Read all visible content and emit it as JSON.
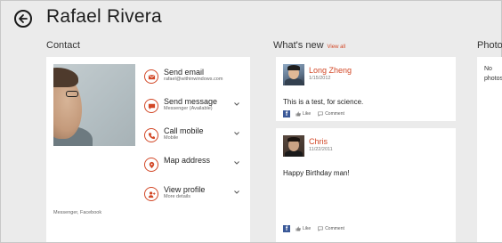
{
  "header": {
    "title": "Rafael Rivera"
  },
  "contact": {
    "heading": "Contact",
    "photo_caption": "Messenger, Facebook",
    "actions": [
      {
        "label": "Send email",
        "sub": "rafael@withinwindows.com",
        "icon": "mail-icon",
        "chevron": false
      },
      {
        "label": "Send message",
        "sub": "Messenger (Available)",
        "icon": "chat-icon",
        "chevron": true
      },
      {
        "label": "Call mobile",
        "sub": "Mobile",
        "icon": "phone-icon",
        "chevron": true
      },
      {
        "label": "Map address",
        "sub": "",
        "icon": "map-pin-icon",
        "chevron": true
      },
      {
        "label": "View profile",
        "sub": "More details",
        "icon": "person-icon",
        "chevron": true
      }
    ]
  },
  "whats_new": {
    "heading": "What's new",
    "view_all": "View all",
    "posts": [
      {
        "name": "Long Zheng",
        "date": "1/15/2012",
        "text": "This is a test, for science.",
        "like": "Like",
        "comment": "Comment"
      },
      {
        "name": "Chris",
        "date": "11/22/2011",
        "text": "Happy Birthday man!",
        "like": "Like",
        "comment": "Comment"
      }
    ]
  },
  "photos": {
    "heading": "Photos",
    "empty_text": "No photos"
  },
  "colors": {
    "accent": "#d24726",
    "background": "#ebebeb",
    "card": "#ffffff",
    "facebook": "#3b5998"
  }
}
